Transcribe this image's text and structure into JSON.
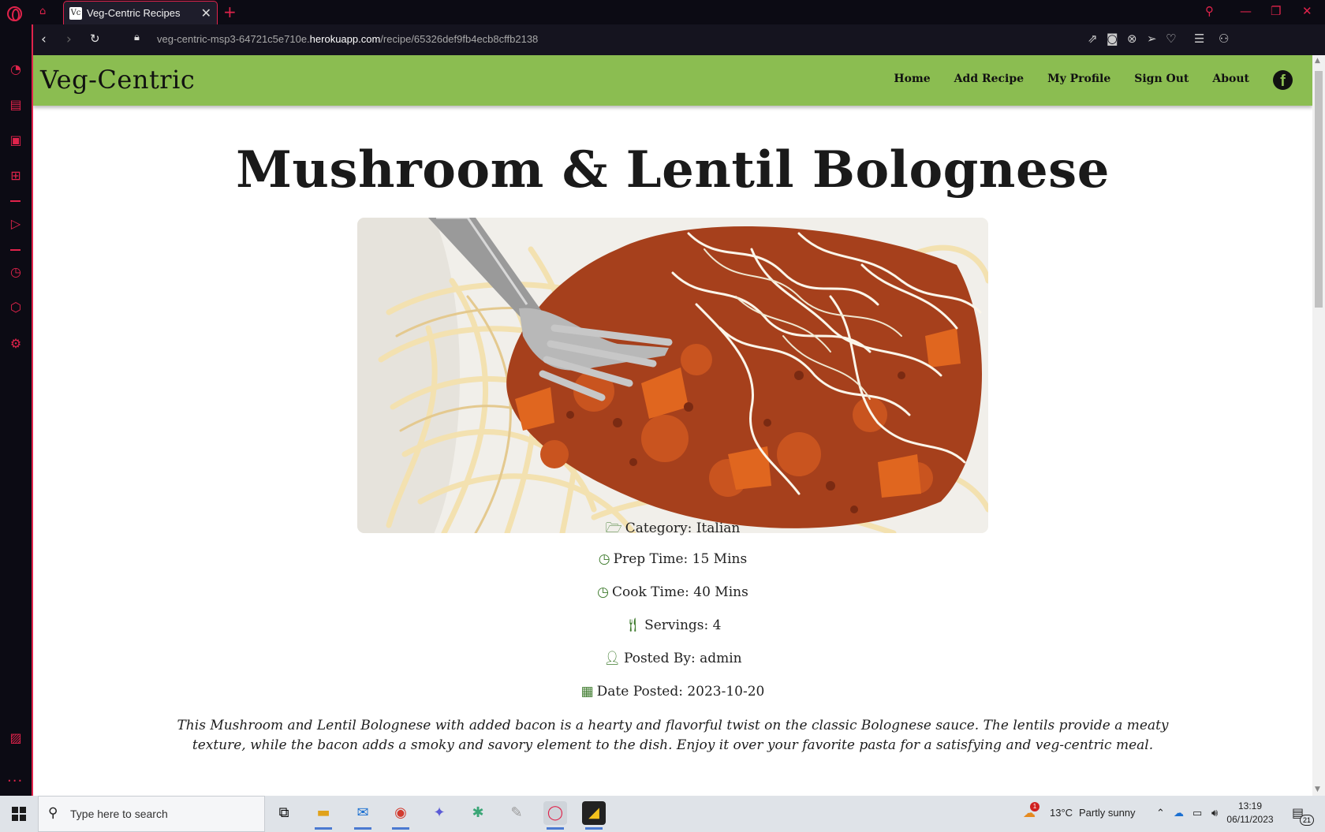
{
  "browser": {
    "tab_title": "Veg-Centric Recipes",
    "tab_favicon_text": "Vc",
    "url_prefix": "veg-centric-msp3-64721c5e710e.",
    "url_host": "herokuapp.com",
    "url_path": "/recipe/65326def9fb4ecb8cffb2138"
  },
  "site": {
    "brand": "Veg-Centric",
    "nav": {
      "home": "Home",
      "add_recipe": "Add Recipe",
      "my_profile": "My Profile",
      "sign_out": "Sign Out",
      "about": "About"
    },
    "social_icon": "facebook-icon"
  },
  "recipe": {
    "title": "Mushroom & Lentil Bolognese",
    "image_icon": "spaghetti-bolognese-photo",
    "category": "Category: Italian",
    "prep_time": "Prep Time: 15 Mins",
    "cook_time": "Cook Time: 40 Mins",
    "servings": "Servings: 4",
    "posted_by": "Posted By: admin",
    "date_posted": "Date Posted: 2023-10-20",
    "description": "This Mushroom and Lentil Bolognese with added bacon is a hearty and flavorful twist on the classic Bolognese sauce. The lentils provide a meaty texture, while the bacon adds a smoky and savory element to the dish. Enjoy it over your favorite pasta for a satisfying and veg-centric meal."
  },
  "taskbar": {
    "search_placeholder": "Type here to search",
    "weather_temp": "13°C",
    "weather_text": "Partly sunny",
    "weather_alert": "1",
    "time": "13:19",
    "date": "06/11/2023",
    "notification_count": "21"
  },
  "colors": {
    "opera_accent": "#e0234b",
    "nav_green": "#8bbd51",
    "icon_green": "#3d7a2c"
  }
}
